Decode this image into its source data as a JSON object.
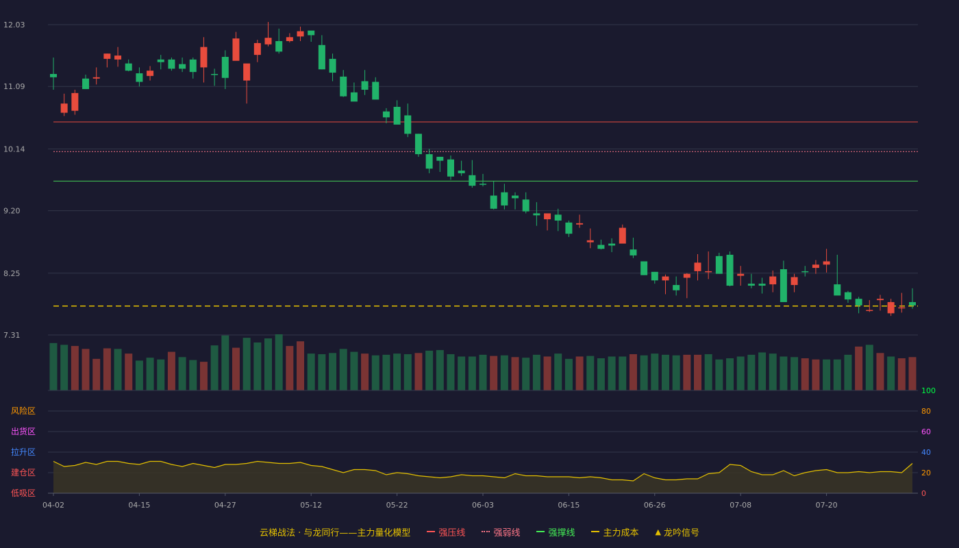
{
  "chart_data": {
    "type": "candlestick",
    "title": "",
    "dates": [
      "04-02",
      "04-03",
      "04-07",
      "04-08",
      "04-09",
      "04-10",
      "04-11",
      "04-14",
      "04-15",
      "04-16",
      "04-17",
      "04-18",
      "04-21",
      "04-22",
      "04-23",
      "04-24",
      "04-25",
      "04-27",
      "04-28",
      "04-29",
      "04-30",
      "05-06",
      "05-07",
      "05-08",
      "05-09",
      "05-12",
      "05-13",
      "05-14",
      "05-15",
      "05-16",
      "05-19",
      "05-20",
      "05-21",
      "05-22",
      "05-23",
      "05-26",
      "05-27",
      "05-28",
      "05-29",
      "05-30",
      "06-03",
      "06-04",
      "06-05",
      "06-06",
      "06-09",
      "06-10",
      "06-11",
      "06-12",
      "06-13",
      "06-15",
      "06-16",
      "06-17",
      "06-18",
      "06-19",
      "06-20",
      "06-23",
      "06-24",
      "06-25",
      "06-26",
      "06-27",
      "06-30",
      "07-01",
      "07-02",
      "07-03",
      "07-04",
      "07-07",
      "07-08",
      "07-09",
      "07-10",
      "07-11",
      "07-14",
      "07-15",
      "07-16",
      "07-17",
      "07-18",
      "07-20",
      "07-21",
      "07-22",
      "07-23",
      "07-24",
      "07-25"
    ],
    "open": [
      11.28,
      10.69,
      10.72,
      11.21,
      11.21,
      11.51,
      11.5,
      11.44,
      11.29,
      11.25,
      11.5,
      11.5,
      11.43,
      11.5,
      11.38,
      11.28,
      11.54,
      11.48,
      11.18,
      11.57,
      11.73,
      11.78,
      11.78,
      11.85,
      11.94,
      11.72,
      11.51,
      11.24,
      11.0,
      11.17,
      11.16,
      10.71,
      10.78,
      10.65,
      10.37,
      10.06,
      10.02,
      9.98,
      9.81,
      9.74,
      9.61,
      9.43,
      9.48,
      9.43,
      9.37,
      9.16,
      9.07,
      9.14,
      9.02,
      8.99,
      8.72,
      8.68,
      8.7,
      8.7,
      8.61,
      8.43,
      8.27,
      8.14,
      8.07,
      8.18,
      8.28,
      8.28,
      8.51,
      8.53,
      8.21,
      8.09,
      8.09,
      8.08,
      8.31,
      8.07,
      8.28,
      8.33,
      8.38,
      8.08,
      7.96,
      7.86,
      7.69,
      7.84,
      7.64,
      7.73,
      7.81
    ],
    "close": [
      11.23,
      10.83,
      10.99,
      11.05,
      11.23,
      11.59,
      11.56,
      11.33,
      11.16,
      11.33,
      11.46,
      11.36,
      11.36,
      11.31,
      11.69,
      11.27,
      11.22,
      11.82,
      11.44,
      11.75,
      11.83,
      11.62,
      11.84,
      11.93,
      11.87,
      11.35,
      11.3,
      10.94,
      10.86,
      11.04,
      10.89,
      10.62,
      10.51,
      10.37,
      10.06,
      9.84,
      9.96,
      9.72,
      9.77,
      9.58,
      9.6,
      9.23,
      9.28,
      9.39,
      9.19,
      9.13,
      9.16,
      9.05,
      8.85,
      9.01,
      8.75,
      8.62,
      8.67,
      8.94,
      8.52,
      8.22,
      8.14,
      8.2,
      7.99,
      8.24,
      8.41,
      8.28,
      8.24,
      8.06,
      8.24,
      8.06,
      8.06,
      8.2,
      7.81,
      8.19,
      8.27,
      8.38,
      8.43,
      7.91,
      7.85,
      7.76,
      7.69,
      7.86,
      7.81,
      7.73,
      7.76
    ],
    "high": [
      11.53,
      10.98,
      11.04,
      11.27,
      11.38,
      11.59,
      11.69,
      11.5,
      11.38,
      11.4,
      11.57,
      11.53,
      11.53,
      11.53,
      11.84,
      11.36,
      11.64,
      11.92,
      11.28,
      11.8,
      12.07,
      11.97,
      11.9,
      12.0,
      11.93,
      11.87,
      11.59,
      11.34,
      11.15,
      11.34,
      11.23,
      10.76,
      10.88,
      10.83,
      10.37,
      10.14,
      10.02,
      10.04,
      9.96,
      9.97,
      9.76,
      9.65,
      9.61,
      9.48,
      9.48,
      9.33,
      9.08,
      9.23,
      9.05,
      9.14,
      8.93,
      8.76,
      8.78,
      8.99,
      8.79,
      8.41,
      8.27,
      8.23,
      8.2,
      8.25,
      8.54,
      8.58,
      8.56,
      8.58,
      8.36,
      8.24,
      8.18,
      8.29,
      8.44,
      8.24,
      8.36,
      8.45,
      8.62,
      8.53,
      7.98,
      7.89,
      7.84,
      7.92,
      7.86,
      7.95,
      8.02
    ],
    "low": [
      11.04,
      10.64,
      10.66,
      11.05,
      11.12,
      11.38,
      11.39,
      11.32,
      11.09,
      11.18,
      11.35,
      11.33,
      11.31,
      11.21,
      11.15,
      11.1,
      11.05,
      11.52,
      10.83,
      11.46,
      11.7,
      11.59,
      11.76,
      11.78,
      11.77,
      11.35,
      11.17,
      10.93,
      10.87,
      10.96,
      10.9,
      10.53,
      10.55,
      10.32,
      10.02,
      9.77,
      9.79,
      9.67,
      9.73,
      9.55,
      9.57,
      9.22,
      9.22,
      9.22,
      9.16,
      8.97,
      8.9,
      8.89,
      8.8,
      8.94,
      8.63,
      8.61,
      8.57,
      8.76,
      8.48,
      8.22,
      8.09,
      7.93,
      7.91,
      7.87,
      8.14,
      8.16,
      8.24,
      8.05,
      8.06,
      8.02,
      7.94,
      7.96,
      7.81,
      7.96,
      8.2,
      8.24,
      8.26,
      7.95,
      7.8,
      7.64,
      7.66,
      7.68,
      7.6,
      7.65,
      7.71
    ],
    "volume": [
      81,
      78,
      76,
      71,
      54,
      72,
      71,
      63,
      51,
      56,
      53,
      66,
      57,
      52,
      49,
      77,
      94,
      73,
      90,
      82,
      89,
      96,
      76,
      84,
      63,
      62,
      64,
      71,
      66,
      63,
      60,
      61,
      63,
      62,
      64,
      68,
      69,
      62,
      58,
      58,
      61,
      59,
      60,
      57,
      56,
      61,
      58,
      63,
      54,
      58,
      59,
      55,
      58,
      58,
      62,
      60,
      63,
      61,
      60,
      61,
      61,
      62,
      53,
      55,
      58,
      61,
      65,
      63,
      58,
      57,
      55,
      53,
      53,
      53,
      61,
      75,
      78,
      64,
      58,
      55,
      57
    ],
    "volume_up": [
      false,
      false,
      true,
      true,
      true,
      true,
      false,
      true,
      false,
      false,
      false,
      true,
      false,
      false,
      true,
      false,
      false,
      true,
      false,
      false,
      false,
      false,
      true,
      true,
      false,
      false,
      false,
      false,
      false,
      true,
      false,
      false,
      false,
      false,
      true,
      false,
      false,
      false,
      false,
      false,
      false,
      true,
      false,
      true,
      false,
      false,
      true,
      false,
      false,
      true,
      false,
      false,
      false,
      false,
      true,
      false,
      false,
      false,
      false,
      true,
      true,
      false,
      false,
      false,
      false,
      false,
      false,
      false,
      false,
      false,
      true,
      true,
      false,
      false,
      false,
      true,
      false,
      true,
      false,
      true,
      true
    ],
    "y_ticks": [
      "12.03",
      "11.09",
      "10.14",
      "9.20",
      "8.25",
      "7.31"
    ],
    "ylim": [
      7.31,
      12.03
    ],
    "x_ticks": [
      "04-02",
      "04-15",
      "04-27",
      "05-12",
      "05-22",
      "06-03",
      "06-15",
      "06-26",
      "07-08",
      "07-20"
    ],
    "x_tick_indices": [
      0,
      8,
      16,
      24,
      32,
      40,
      48,
      56,
      64,
      72
    ],
    "lines": {
      "strong_pressure": 10.55,
      "strong_weak": 10.1,
      "strong_support": 9.65,
      "main_cost": 7.75
    },
    "oscillator": {
      "values": [
        31,
        26,
        27,
        30,
        28,
        31,
        31,
        29,
        28,
        31,
        31,
        28,
        26,
        29,
        27,
        25,
        28,
        28,
        29,
        31,
        30,
        29,
        29,
        30,
        27,
        26,
        23,
        20,
        23,
        23,
        22,
        18,
        20,
        19,
        17,
        16,
        15,
        16,
        18,
        17,
        17,
        16,
        15,
        19,
        17,
        17,
        16,
        16,
        16,
        15,
        16,
        15,
        13,
        13,
        12,
        19,
        15,
        13,
        13,
        14,
        14,
        19,
        20,
        28,
        27,
        21,
        18,
        18,
        22,
        17,
        20,
        22,
        23,
        20,
        20,
        21,
        20,
        21,
        21,
        20,
        29
      ],
      "right_ticks": [
        "100",
        "80",
        "60",
        "40",
        "20",
        "0"
      ],
      "right_tick_colors": [
        "#00ff44",
        "#ff9900",
        "#ff55ff",
        "#4488ff",
        "#ff9900",
        "#ff5555"
      ],
      "zones": [
        "风险区",
        "出货区",
        "拉升区",
        "建仓区",
        "低吸区"
      ],
      "zone_colors": [
        "#ff9900",
        "#ff55ff",
        "#4488ff",
        "#ff5555",
        "#ff5555"
      ],
      "ylim": [
        0,
        100
      ]
    },
    "grid": true
  },
  "colors": {
    "background": "#1a1a2e",
    "up": "#e84c3d",
    "down": "#21b36a",
    "vol_up": "#7a3434",
    "vol_down": "#1f5a42",
    "grid": "#33374a",
    "axis_text": "#aaaaaa",
    "line_pressure": "#e84c3d",
    "line_weak": "#ff7788",
    "line_support": "#44cc55",
    "line_cost": "#e5c100",
    "osc_line": "#e5c100",
    "osc_fill": "#3a3524"
  },
  "legend": {
    "model_name": "云梯战法 · 与龙同行——主力量化模型",
    "items": [
      {
        "label": "强压线",
        "color": "#ff5555",
        "style": "solid"
      },
      {
        "label": "强弱线",
        "color": "#ff7788",
        "style": "dotted"
      },
      {
        "label": "强撑线",
        "color": "#44ee55",
        "style": "solid"
      },
      {
        "label": "主力成本",
        "color": "#e5c100",
        "style": "dashed"
      },
      {
        "label": "龙吟信号",
        "color": "#e5c100",
        "style": "triangle"
      }
    ]
  }
}
